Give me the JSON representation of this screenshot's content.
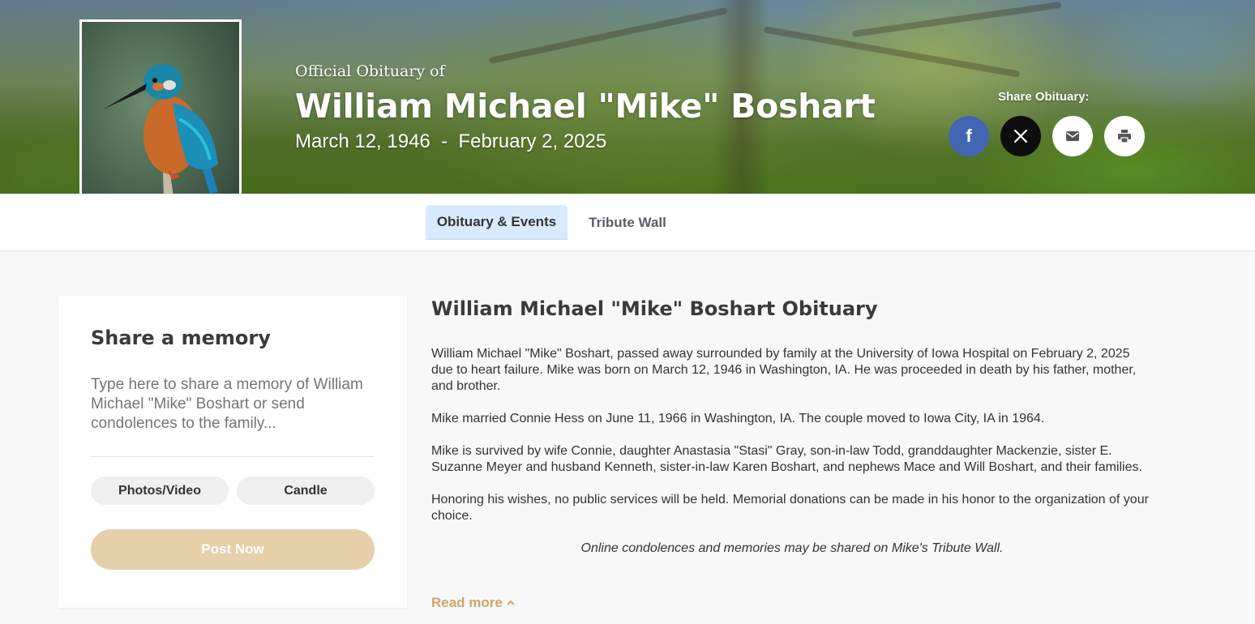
{
  "header": {
    "official_label": "Official Obituary of",
    "name": "William Michael \"Mike\" Boshart",
    "dates": "March 12, 1946  -  February 2, 2025"
  },
  "share": {
    "label": "Share Obituary:",
    "facebook_glyph": "f",
    "icons": [
      "facebook-icon",
      "x-icon",
      "email-icon",
      "print-icon"
    ]
  },
  "tabs": [
    {
      "label": "Obituary & Events",
      "active": true
    },
    {
      "label": "Tribute Wall",
      "active": false
    }
  ],
  "memory": {
    "title": "Share a memory",
    "placeholder": "Type here to share a memory of William Michael \"Mike\" Boshart or send condolences to the family...",
    "photos_label": "Photos/Video",
    "candle_label": "Candle",
    "post_label": "Post Now"
  },
  "obituary": {
    "title": "William Michael \"Mike\" Boshart Obituary",
    "paragraphs": [
      "William Michael \"Mike\" Boshart, passed away surrounded by family at the University of Iowa Hospital on February 2, 2025 due to heart failure. Mike was born on March 12, 1946 in Washington, IA. He was proceeded in death by his father, mother, and brother.",
      "Mike married Connie Hess on June 11, 1966 in Washington, IA. The couple moved to Iowa City, IA in 1964.",
      "Mike is survived by wife Connie, daughter Anastasia \"Stasi\" Gray, son-in-law Todd, granddaughter Mackenzie, sister E. Suzanne Meyer and husband Kenneth, sister-in-law Karen Boshart, and nephews Mace and Will Boshart, and their families.",
      "Honoring his wishes, no public services will be held. Memorial donations can be made in his honor to the organization of your choice."
    ],
    "closing": "Online condolences and memories may be shared on Mike's Tribute Wall.",
    "read_more": "Read more"
  },
  "colors": {
    "facebook": "#4266b2",
    "x": "#0d0d0d",
    "tab_active_bg": "#d8eafd",
    "post_button": "#e5d0aa",
    "read_more": "#cda66b"
  }
}
